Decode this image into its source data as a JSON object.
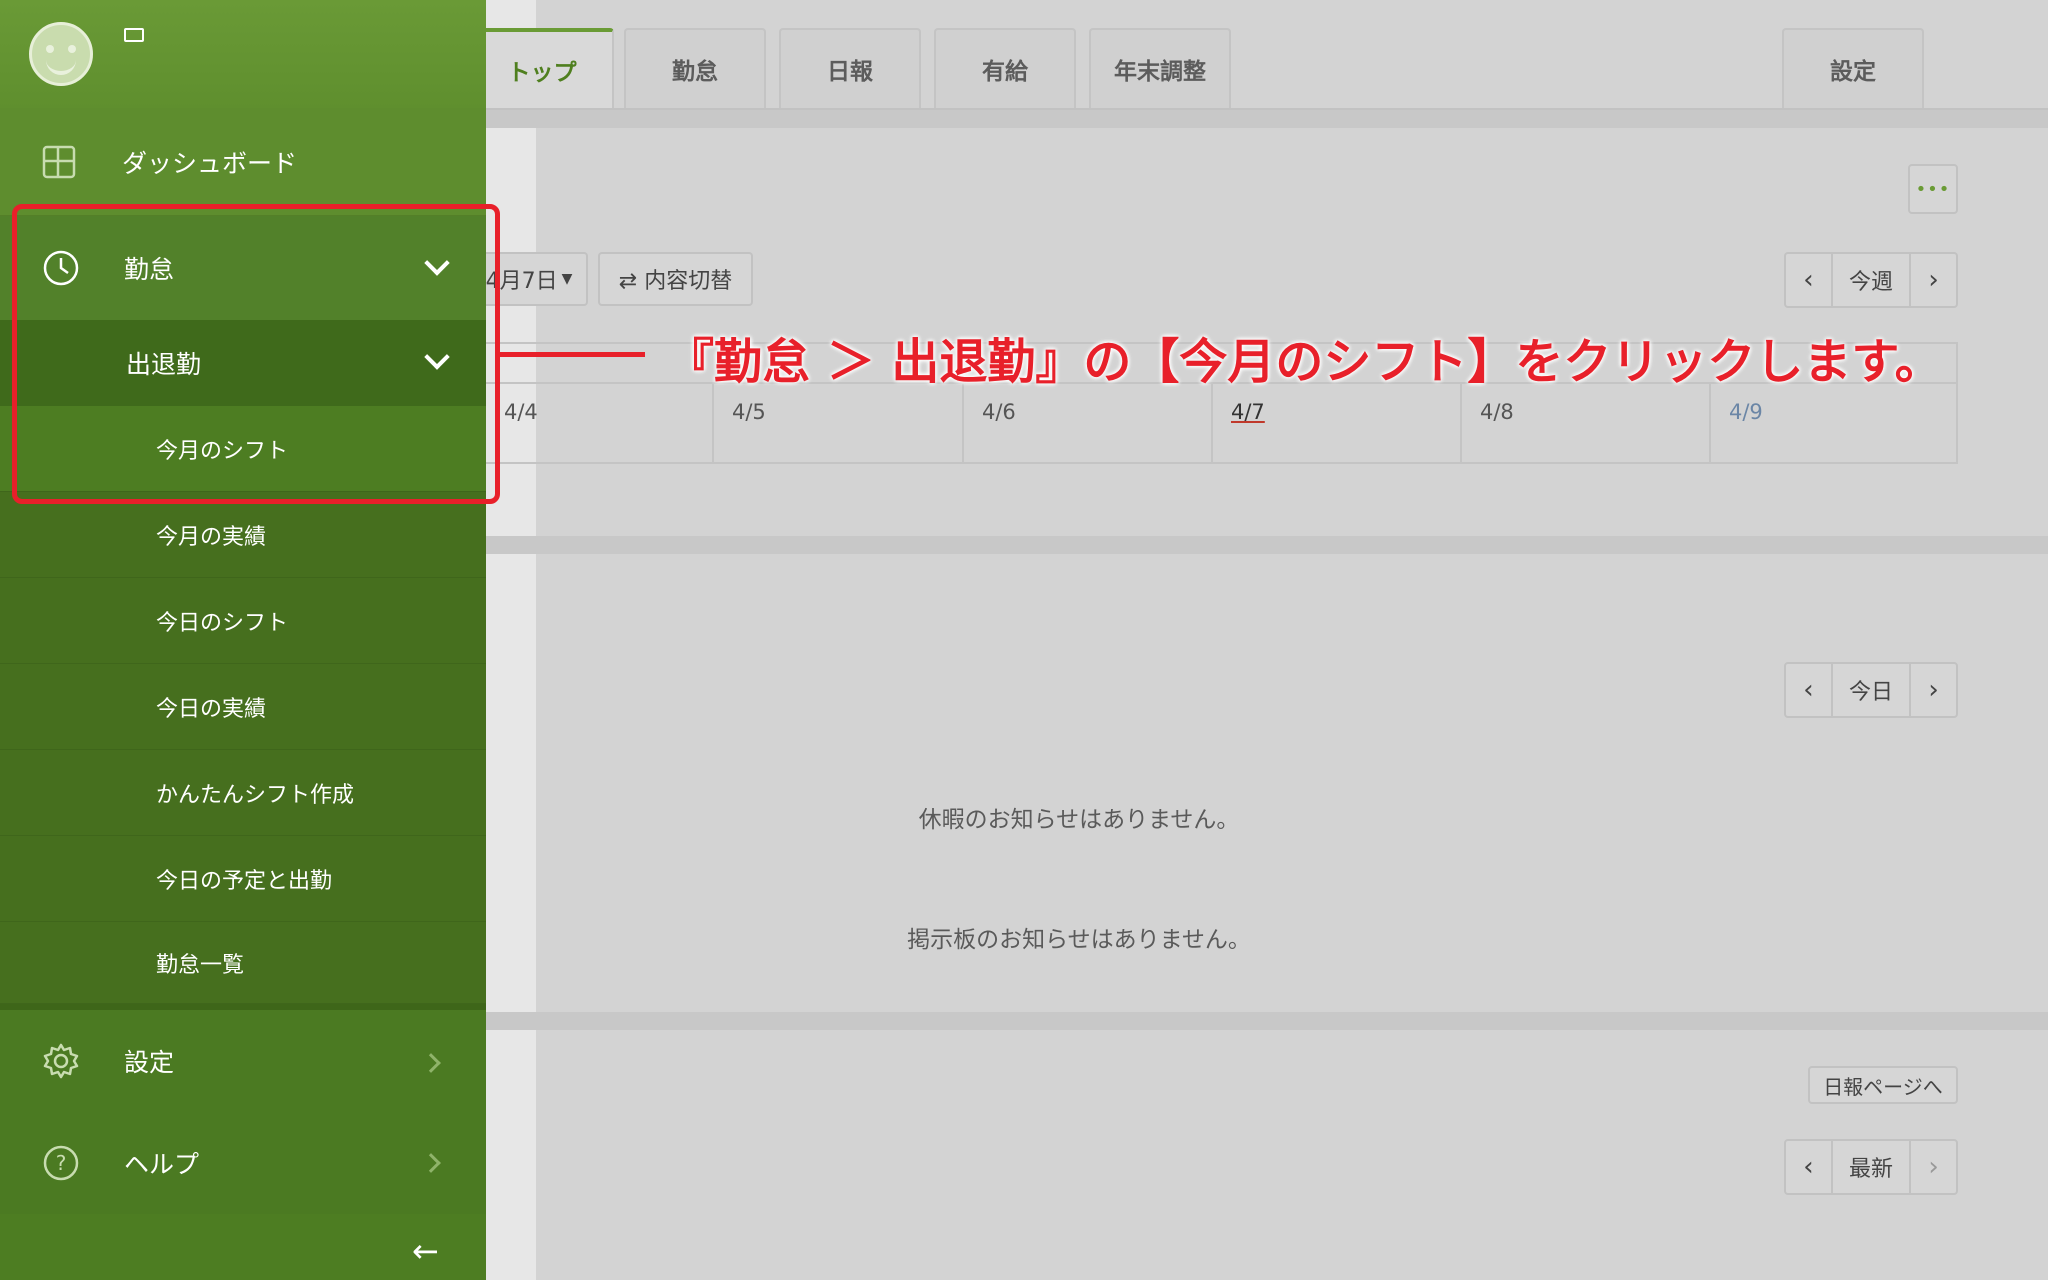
{
  "tabs": [
    "トップ",
    "勤怠",
    "日報",
    "有給",
    "年末調整"
  ],
  "settings_tab": "設定",
  "main": {
    "more_icon": "•••",
    "date_select": "4月7日",
    "toggle_btn": "⇄ 内容切替",
    "week_pager": "今週",
    "days": [
      "4/4",
      "4/5",
      "4/6",
      "4/7",
      "4/8",
      "4/9"
    ],
    "day_pager": "今日",
    "notice_leave": "休暇のお知らせはありません。",
    "notice_board": "掲示板のお知らせはありません。",
    "report_link": "日報ページへ",
    "latest_pager": "最新"
  },
  "sidebar": {
    "dashboard": "ダッシュボード",
    "kintai": "勤怠",
    "shuttaikin": "出退勤",
    "sub_items": [
      "今月のシフト",
      "今月の実績",
      "今日のシフト",
      "今日の実績",
      "かんたんシフト作成",
      "今日の予定と出勤",
      "勤怠一覧"
    ],
    "settings": "設定",
    "help": "ヘルプ"
  },
  "annotation": "『勤怠 ＞ 出退勤』の【今月のシフト】をクリックします。",
  "colors": {
    "sidebar": "#4d7d22",
    "accent": "#6a9b35",
    "annotation": "#e8202a"
  }
}
